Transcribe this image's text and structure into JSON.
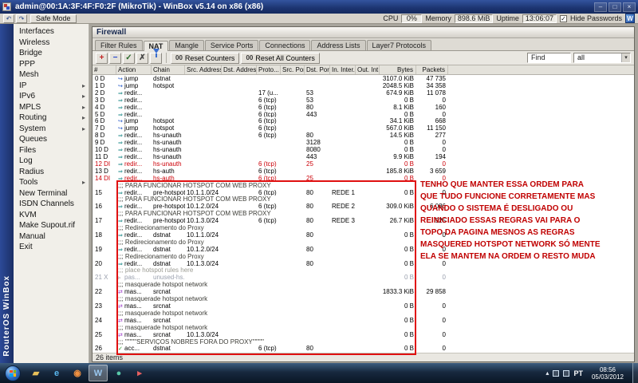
{
  "window": {
    "title": "admin@00:1A:3F:4F:F0:2F (MikroTik) - WinBox v5.14 on x86 (x86)",
    "brand_vertical": "RouterOS WinBox",
    "controls": {
      "minimize": "–",
      "maximize": "□",
      "close": "×"
    }
  },
  "toolbar": {
    "undo_icon": "↶",
    "redo_icon": "↷",
    "safe_mode": "Safe Mode",
    "cpu_label": "CPU",
    "cpu_value": "0%",
    "memory_label": "Memory",
    "memory_value": "898.6 MiB",
    "uptime_label": "Uptime",
    "uptime_value": "13:06:07",
    "hide_passwords": "Hide Passwords",
    "hide_passwords_checked": "✓",
    "winbox_logo": "W"
  },
  "sidebar": {
    "items": [
      {
        "label": "Interfaces",
        "submenu": false
      },
      {
        "label": "Wireless",
        "submenu": false
      },
      {
        "label": "Bridge",
        "submenu": false
      },
      {
        "label": "PPP",
        "submenu": false
      },
      {
        "label": "Mesh",
        "submenu": false
      },
      {
        "label": "IP",
        "submenu": true
      },
      {
        "label": "IPv6",
        "submenu": true
      },
      {
        "label": "MPLS",
        "submenu": true
      },
      {
        "label": "Routing",
        "submenu": true
      },
      {
        "label": "System",
        "submenu": true
      },
      {
        "label": "Queues",
        "submenu": false
      },
      {
        "label": "Files",
        "submenu": false
      },
      {
        "label": "Log",
        "submenu": false
      },
      {
        "label": "Radius",
        "submenu": false
      },
      {
        "label": "Tools",
        "submenu": true
      },
      {
        "label": "New Terminal",
        "submenu": false
      },
      {
        "label": "ISDN Channels",
        "submenu": false
      },
      {
        "label": "KVM",
        "submenu": false
      },
      {
        "label": "Make Supout.rif",
        "submenu": false
      },
      {
        "label": "Manual",
        "submenu": false
      },
      {
        "label": "Exit",
        "submenu": false
      }
    ]
  },
  "firewall": {
    "title": "Firewall",
    "tabs": [
      "Filter Rules",
      "NAT",
      "Mangle",
      "Service Ports",
      "Connections",
      "Address Lists",
      "Layer7 Protocols"
    ],
    "active_tab": "NAT",
    "buttons": {
      "reset": "Reset Counters",
      "reset_all": "Reset All Counters",
      "reset_icon": "00"
    },
    "find_label": "Find",
    "filter_value": "all",
    "dropdown_icon": "▾",
    "columns": [
      "#",
      "Action",
      "Chain",
      "Src. Address",
      "Dst. Address",
      "Proto...",
      "Src. Port",
      "Dst. Port",
      "In. Inter...",
      "Out. Int...",
      "Bytes",
      "Packets"
    ],
    "status": "26 items",
    "action_icons": {
      "jump": "↪",
      "redirect": "⇒",
      "masquerade": "⇄",
      "accept": "✓",
      "passthrough": "▹"
    },
    "rows": [
      {
        "type": "rule",
        "num": "0",
        "flags": "D",
        "icon": "jump",
        "action": "jump",
        "chain": "dstnat",
        "bytes": "3107.0 KiB",
        "packets": "47 735"
      },
      {
        "type": "rule",
        "num": "1",
        "flags": "D",
        "icon": "jump",
        "action": "jump",
        "chain": "hotspot",
        "bytes": "2048.5 KiB",
        "packets": "34 358"
      },
      {
        "type": "rule",
        "num": "2",
        "flags": "D",
        "icon": "redirect",
        "action": "redir...",
        "proto": "17 (u...",
        "dport": "53",
        "bytes": "674.9 KiB",
        "packets": "11 078"
      },
      {
        "type": "rule",
        "num": "3",
        "flags": "D",
        "icon": "redirect",
        "action": "redir...",
        "proto": "6 (tcp)",
        "dport": "53",
        "bytes": "0 B",
        "packets": "0"
      },
      {
        "type": "rule",
        "num": "4",
        "flags": "D",
        "icon": "redirect",
        "action": "redir...",
        "proto": "6 (tcp)",
        "dport": "80",
        "bytes": "8.1 KiB",
        "packets": "160"
      },
      {
        "type": "rule",
        "num": "5",
        "flags": "D",
        "icon": "redirect",
        "action": "redir...",
        "proto": "6 (tcp)",
        "dport": "443",
        "bytes": "0 B",
        "packets": "0"
      },
      {
        "type": "rule",
        "num": "6",
        "flags": "D",
        "icon": "jump",
        "action": "jump",
        "chain": "hotspot",
        "proto": "6 (tcp)",
        "bytes": "34.1 KiB",
        "packets": "668"
      },
      {
        "type": "rule",
        "num": "7",
        "flags": "D",
        "icon": "jump",
        "action": "jump",
        "chain": "hotspot",
        "proto": "6 (tcp)",
        "bytes": "567.0 KiB",
        "packets": "11 150"
      },
      {
        "type": "rule",
        "num": "8",
        "flags": "D",
        "icon": "redirect",
        "action": "redir...",
        "chain": "hs-unauth",
        "proto": "6 (tcp)",
        "dport": "80",
        "bytes": "14.5 KiB",
        "packets": "277"
      },
      {
        "type": "rule",
        "num": "9",
        "flags": "D",
        "icon": "redirect",
        "action": "redir...",
        "chain": "hs-unauth",
        "dport": "3128",
        "bytes": "0 B",
        "packets": "0"
      },
      {
        "type": "rule",
        "num": "10",
        "flags": "D",
        "icon": "redirect",
        "action": "redir...",
        "chain": "hs-unauth",
        "dport": "8080",
        "bytes": "0 B",
        "packets": "0"
      },
      {
        "type": "rule",
        "num": "11",
        "flags": "D",
        "icon": "redirect",
        "action": "redir...",
        "chain": "hs-unauth",
        "dport": "443",
        "bytes": "9.9 KiB",
        "packets": "194"
      },
      {
        "type": "rule",
        "num": "12",
        "flags": "DI",
        "icon": "redirect",
        "action": "redir...",
        "chain": "hs-unauth",
        "proto": "6 (tcp)",
        "dport": "25",
        "bytes": "0 B",
        "packets": "0",
        "style": "invalid"
      },
      {
        "type": "rule",
        "num": "13",
        "flags": "D",
        "icon": "redirect",
        "action": "redir...",
        "chain": "hs-auth",
        "proto": "6 (tcp)",
        "bytes": "185.8 KiB",
        "packets": "3 659"
      },
      {
        "type": "rule",
        "num": "14",
        "flags": "DI",
        "icon": "redirect",
        "action": "redir...",
        "chain": "hs-auth",
        "proto": "6 (tcp)",
        "dport": "25",
        "bytes": "0 B",
        "packets": "0",
        "style": "invalid"
      },
      {
        "type": "comment",
        "text": ";;; PARA FUNCIONAR HOTSPOT COM WEB PROXY"
      },
      {
        "type": "rule",
        "num": "15",
        "icon": "redirect",
        "action": "redir...",
        "chain": "pre-hotspot",
        "src": "10.1.1.0/24",
        "proto": "6 (tcp)",
        "dport": "80",
        "inif": "REDE 1",
        "bytes": "0 B",
        "packets": "0"
      },
      {
        "type": "comment",
        "text": ";;; PARA FUNCIONAR HOTSPOT COM WEB PROXY"
      },
      {
        "type": "rule",
        "num": "16",
        "icon": "redirect",
        "action": "redir...",
        "chain": "pre-hotspot",
        "src": "10.1.2.0/24",
        "proto": "6 (tcp)",
        "dport": "80",
        "inif": "REDE 2",
        "bytes": "309.0 KiB",
        "packets": "6 086"
      },
      {
        "type": "comment",
        "text": ";;; PARA FUNCIONAR HOTSPOT COM WEB PROXY"
      },
      {
        "type": "rule",
        "num": "17",
        "icon": "redirect",
        "action": "redir...",
        "chain": "pre-hotspot",
        "src": "10.1.3.0/24",
        "proto": "6 (tcp)",
        "dport": "80",
        "inif": "REDE 3",
        "bytes": "26.7 KiB",
        "packets": "525"
      },
      {
        "type": "comment",
        "text": ";;; Redirecionamento do Proxy"
      },
      {
        "type": "rule",
        "num": "18",
        "icon": "redirect",
        "action": "redir...",
        "chain": "dstnat",
        "src": "10.1.1.0/24",
        "dport": "80",
        "bytes": "0 B",
        "packets": "0"
      },
      {
        "type": "comment",
        "text": ";;; Redirecionamento do Proxy"
      },
      {
        "type": "rule",
        "num": "19",
        "icon": "redirect",
        "action": "redir...",
        "chain": "dstnat",
        "src": "10.1.2.0/24",
        "dport": "80",
        "bytes": "0 B",
        "packets": "0"
      },
      {
        "type": "comment",
        "text": ";;; Redirecionamento do Proxy"
      },
      {
        "type": "rule",
        "num": "20",
        "icon": "redirect",
        "action": "redir...",
        "chain": "dstnat",
        "src": "10.1.3.0/24",
        "dport": "80",
        "bytes": "0 B",
        "packets": "0"
      },
      {
        "type": "comment",
        "text": ";;; place hotspot rules here",
        "muted": true
      },
      {
        "type": "rule",
        "num": "21",
        "flags": "X",
        "icon": "passthrough",
        "action": "pas...",
        "chain": "unused-hs...",
        "bytes": "0 B",
        "packets": "0",
        "style": "disabled"
      },
      {
        "type": "comment",
        "text": ";;; masquerade hotspot network"
      },
      {
        "type": "rule",
        "num": "22",
        "icon": "masquerade",
        "action": "mas...",
        "chain": "srcnat",
        "bytes": "1833.3 KiB",
        "packets": "29 858"
      },
      {
        "type": "comment",
        "text": ";;; masquerade hotspot network"
      },
      {
        "type": "rule",
        "num": "23",
        "icon": "masquerade",
        "action": "mas...",
        "chain": "srcnat",
        "bytes": "0 B",
        "packets": "0"
      },
      {
        "type": "comment",
        "text": ";;; masquerade hotspot network"
      },
      {
        "type": "rule",
        "num": "24",
        "icon": "masquerade",
        "action": "mas...",
        "chain": "srcnat",
        "bytes": "0 B",
        "packets": "0"
      },
      {
        "type": "comment",
        "text": ";;; masquerade hotspot network"
      },
      {
        "type": "rule",
        "num": "25",
        "icon": "masquerade",
        "action": "mas...",
        "chain": "srcnat",
        "src": "10.1.3.0/24",
        "bytes": "0 B",
        "packets": "0"
      },
      {
        "type": "comment",
        "text": ";;; \"\"\"\"\"SERVIÇOS NOBRES FORA DO PROXY\"\"\"\"\""
      },
      {
        "type": "rule",
        "num": "26",
        "icon": "accept",
        "action": "acc...",
        "chain": "dstnat",
        "proto": "6 (tcp)",
        "dport": "80",
        "bytes": "0 B",
        "packets": "0"
      }
    ]
  },
  "annotation": {
    "color": "#c00000",
    "lines": [
      "TENHO QUE MANTER ESSA ORDEM PARA",
      "QUE TUDO FUNCIONE CORRETAMENTE MAS",
      "QUANDO O SISTEMA É DESLIGADO OU",
      "REINICIADO ESSAS REGRAS VAI PARA O",
      "TOPO DA PAGINA MESNOS AS REGRAS",
      "MASQUERED HOTSPOT NETWORK SÓ MENTE",
      "ELA SE MANTEM NA ORDEM O RESTO MUDA"
    ]
  },
  "taskbar": {
    "icons": [
      {
        "name": "folder-icon",
        "glyph": "▰",
        "color": "#e8c05a",
        "active": false
      },
      {
        "name": "internet-explorer-icon",
        "glyph": "e",
        "color": "#5ab8f0",
        "active": false
      },
      {
        "name": "media-player-icon",
        "glyph": "◉",
        "color": "#f09040",
        "active": false
      },
      {
        "name": "winbox-icon",
        "glyph": "W",
        "color": "#9ac8f0",
        "active": true
      },
      {
        "name": "globe-icon",
        "glyph": "●",
        "color": "#58c8a8",
        "active": false
      },
      {
        "name": "player-icon",
        "glyph": "▸",
        "color": "#e86060",
        "active": false
      }
    ],
    "tray_arrow": "▴",
    "lang": "PT",
    "time": "08:56",
    "date": "05/03/2012"
  }
}
